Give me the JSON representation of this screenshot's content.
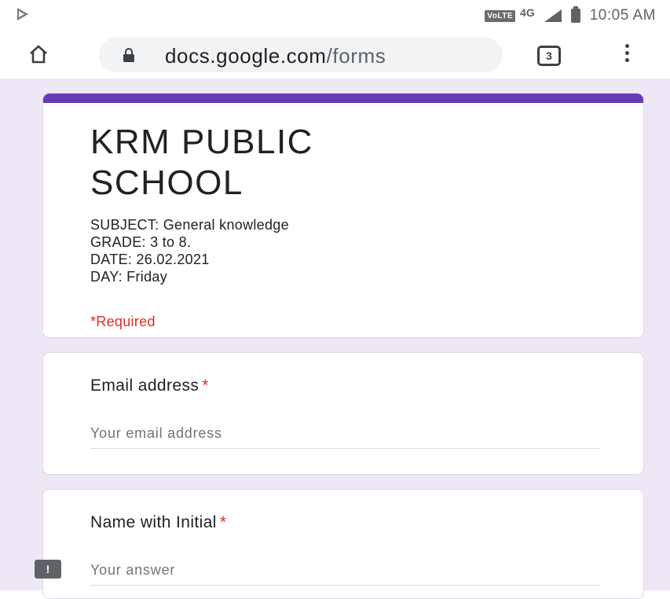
{
  "status_bar": {
    "network_badge": "VoLTE",
    "network_type": "4G",
    "time": "10:05 AM"
  },
  "browser": {
    "url_domain": "docs.google.com",
    "url_path": "/forms",
    "tab_count": "3"
  },
  "form": {
    "accent_color": "#673ab7",
    "background_color": "#ede7f6",
    "title_line1": "KRM PUBLIC",
    "title_line2": "SCHOOL",
    "description": [
      "SUBJECT: General knowledge",
      "GRADE: 3 to 8.",
      "DATE: 26.02.2021",
      "DAY: Friday"
    ],
    "required_note": "*Required",
    "questions": [
      {
        "label": "Email address",
        "required_mark": "*",
        "placeholder": "Your email address"
      },
      {
        "label": "Name with Initial",
        "required_mark": "*",
        "placeholder": "Your answer"
      }
    ]
  },
  "icons": {
    "play": "play-icon",
    "home": "home-icon",
    "lock": "lock-icon",
    "menu": "more-vert-icon",
    "feedback": "feedback-icon",
    "feedback_glyph": "!"
  }
}
